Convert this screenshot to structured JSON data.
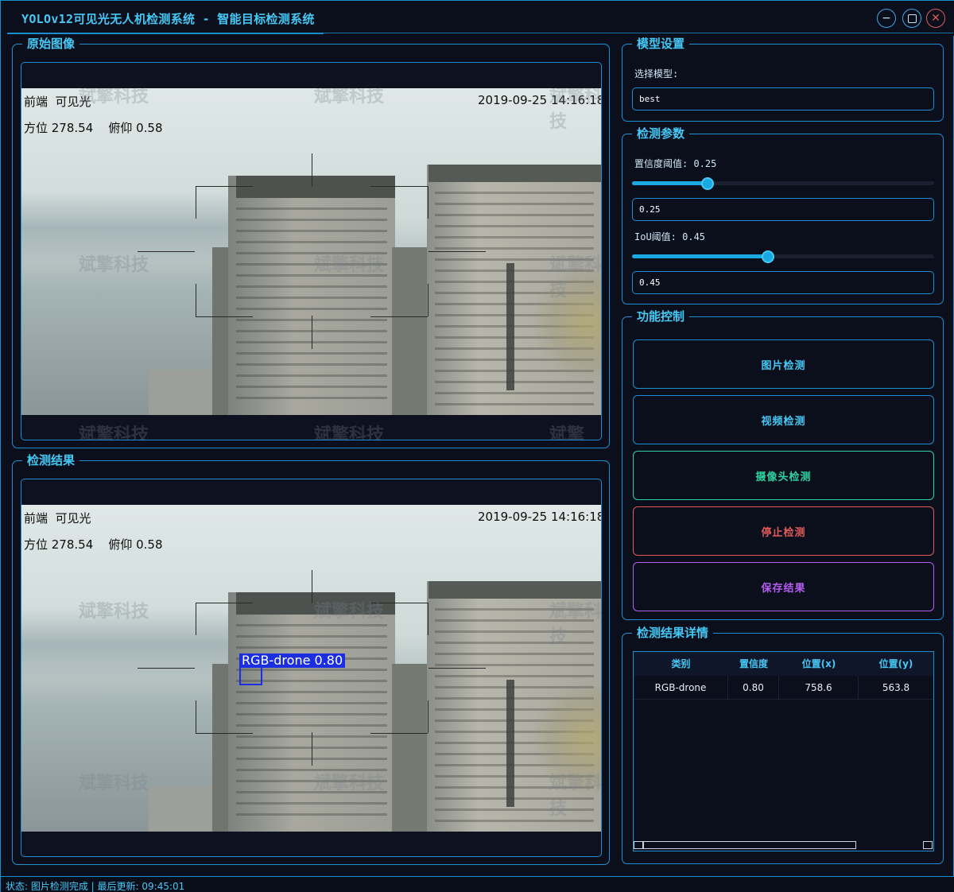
{
  "window": {
    "title": "YOLOv12可见光无人机检测系统 - 智能目标检测系统"
  },
  "original_panel": {
    "title": "原始图像",
    "osd": {
      "line1_left": "前端  可见光",
      "timestamp": "2019-09-25 14:16:18",
      "line2": "方位 278.54    俯仰 0.58"
    }
  },
  "result_panel": {
    "title": "检测结果",
    "osd": {
      "line1_left": "前端  可见光",
      "timestamp": "2019-09-25 14:16:18",
      "line2": "方位 278.54    俯仰 0.58"
    },
    "detection_label": "RGB-drone 0.80"
  },
  "watermark_text": "斌擎科技",
  "model_settings": {
    "title": "模型设置",
    "select_label": "选择模型:",
    "selected_model": "best"
  },
  "detect_params": {
    "title": "检测参数",
    "conf_label": "置信度阈值: 0.25",
    "conf_value": "0.25",
    "conf_slider": 0.25,
    "iou_label": "IoU阈值: 0.45",
    "iou_value": "0.45",
    "iou_slider": 0.45
  },
  "controls": {
    "title": "功能控制",
    "image_detect": "图片检测",
    "video_detect": "视频检测",
    "camera_detect": "摄像头检测",
    "stop_detect": "停止检测",
    "save_result": "保存结果"
  },
  "details": {
    "title": "检测结果详情",
    "columns": [
      "类别",
      "置信度",
      "位置(x)",
      "位置(y)"
    ],
    "rows": [
      [
        "RGB-drone",
        "0.80",
        "758.6",
        "563.8"
      ]
    ]
  },
  "status": {
    "text": "状态: 图片检测完成 | 最后更新: 09:45:01"
  },
  "colors": {
    "accent": "#46c8f5",
    "border": "#1e8fd0",
    "stop": "#e05a5a",
    "save": "#b45cf0",
    "camera": "#2fd3a0",
    "detection_box": "#1c2fe0"
  }
}
